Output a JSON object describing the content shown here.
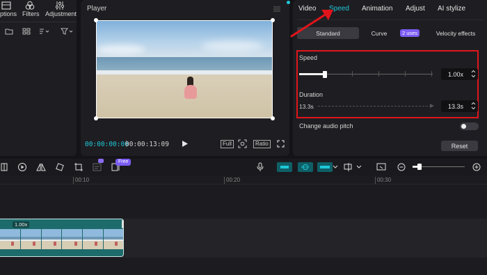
{
  "left_toolbar": {
    "options_label": "ptions",
    "filters_label": "Filters",
    "adjustment_label": "Adjustment"
  },
  "player": {
    "title": "Player",
    "current_time": "00:00:00:00",
    "total_time": "00:00:13:09",
    "full_label": "Full",
    "ratio_label": "Ratio"
  },
  "inspector": {
    "tabs": [
      "Video",
      "Speed",
      "Animation",
      "Adjust",
      "AI stylize"
    ],
    "active_tab": "Speed",
    "modes": {
      "standard": "Standard",
      "curve": "Curve",
      "uses_badge": "2 uses",
      "velocity": "Velocity effects"
    },
    "speed": {
      "label": "Speed",
      "value": "1.00x",
      "slider_fraction": 0.2
    },
    "duration": {
      "label": "Duration",
      "from": "13.3s",
      "to": "13.3s"
    },
    "audio_pitch_label": "Change audio pitch",
    "reset_label": "Reset"
  },
  "toolbar": {
    "free_badge": "Free"
  },
  "timeline": {
    "marks": [
      "00:10",
      "00:20",
      "00:30"
    ],
    "clip_speed_label": "1.00x"
  },
  "colors": {
    "accent": "#1ec8d8",
    "highlight_box": "#e0151b",
    "badge_purple": "#7b5cf5",
    "clip_teal": "#1d6b6b"
  }
}
